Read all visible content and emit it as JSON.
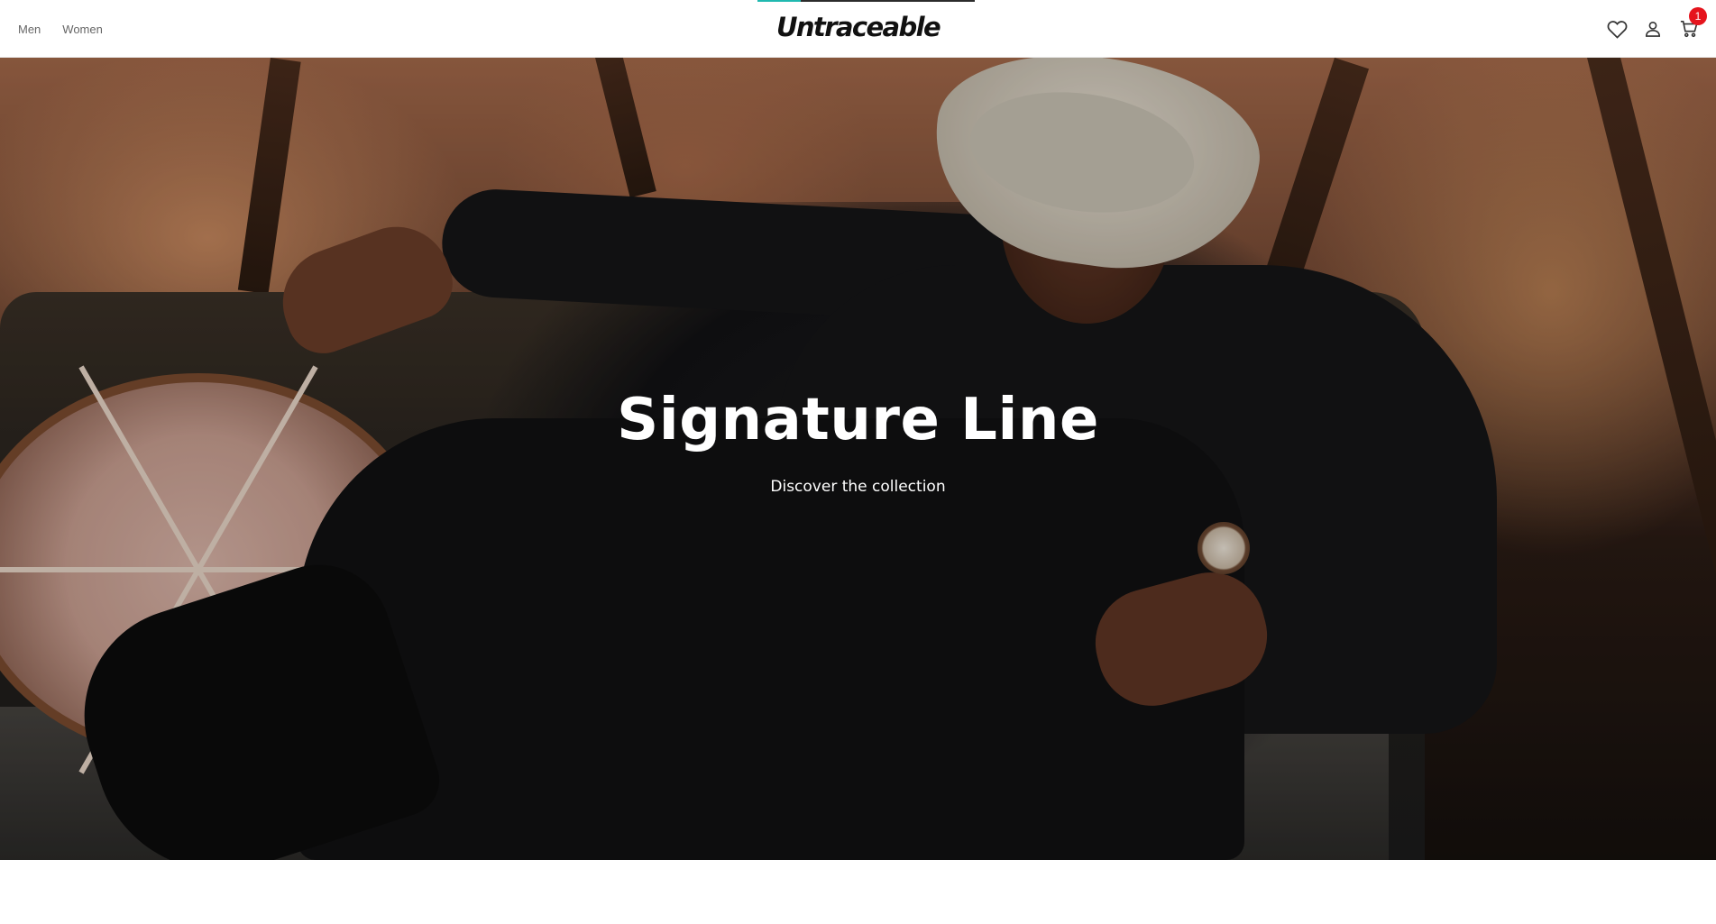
{
  "header": {
    "nav": [
      {
        "label": "Men"
      },
      {
        "label": "Women"
      }
    ],
    "logo": "Untraceable",
    "loading_progress": 0.2,
    "icons": {
      "wishlist": "heart-icon",
      "account": "user-icon",
      "cart": "cart-icon"
    },
    "cart_count": "1"
  },
  "hero": {
    "title": "Signature Line",
    "cta": "Discover the collection"
  },
  "colors": {
    "accent": "#20b9b0",
    "badge": "#e5141d",
    "text_dark": "#111111",
    "nav_text": "#666666"
  }
}
